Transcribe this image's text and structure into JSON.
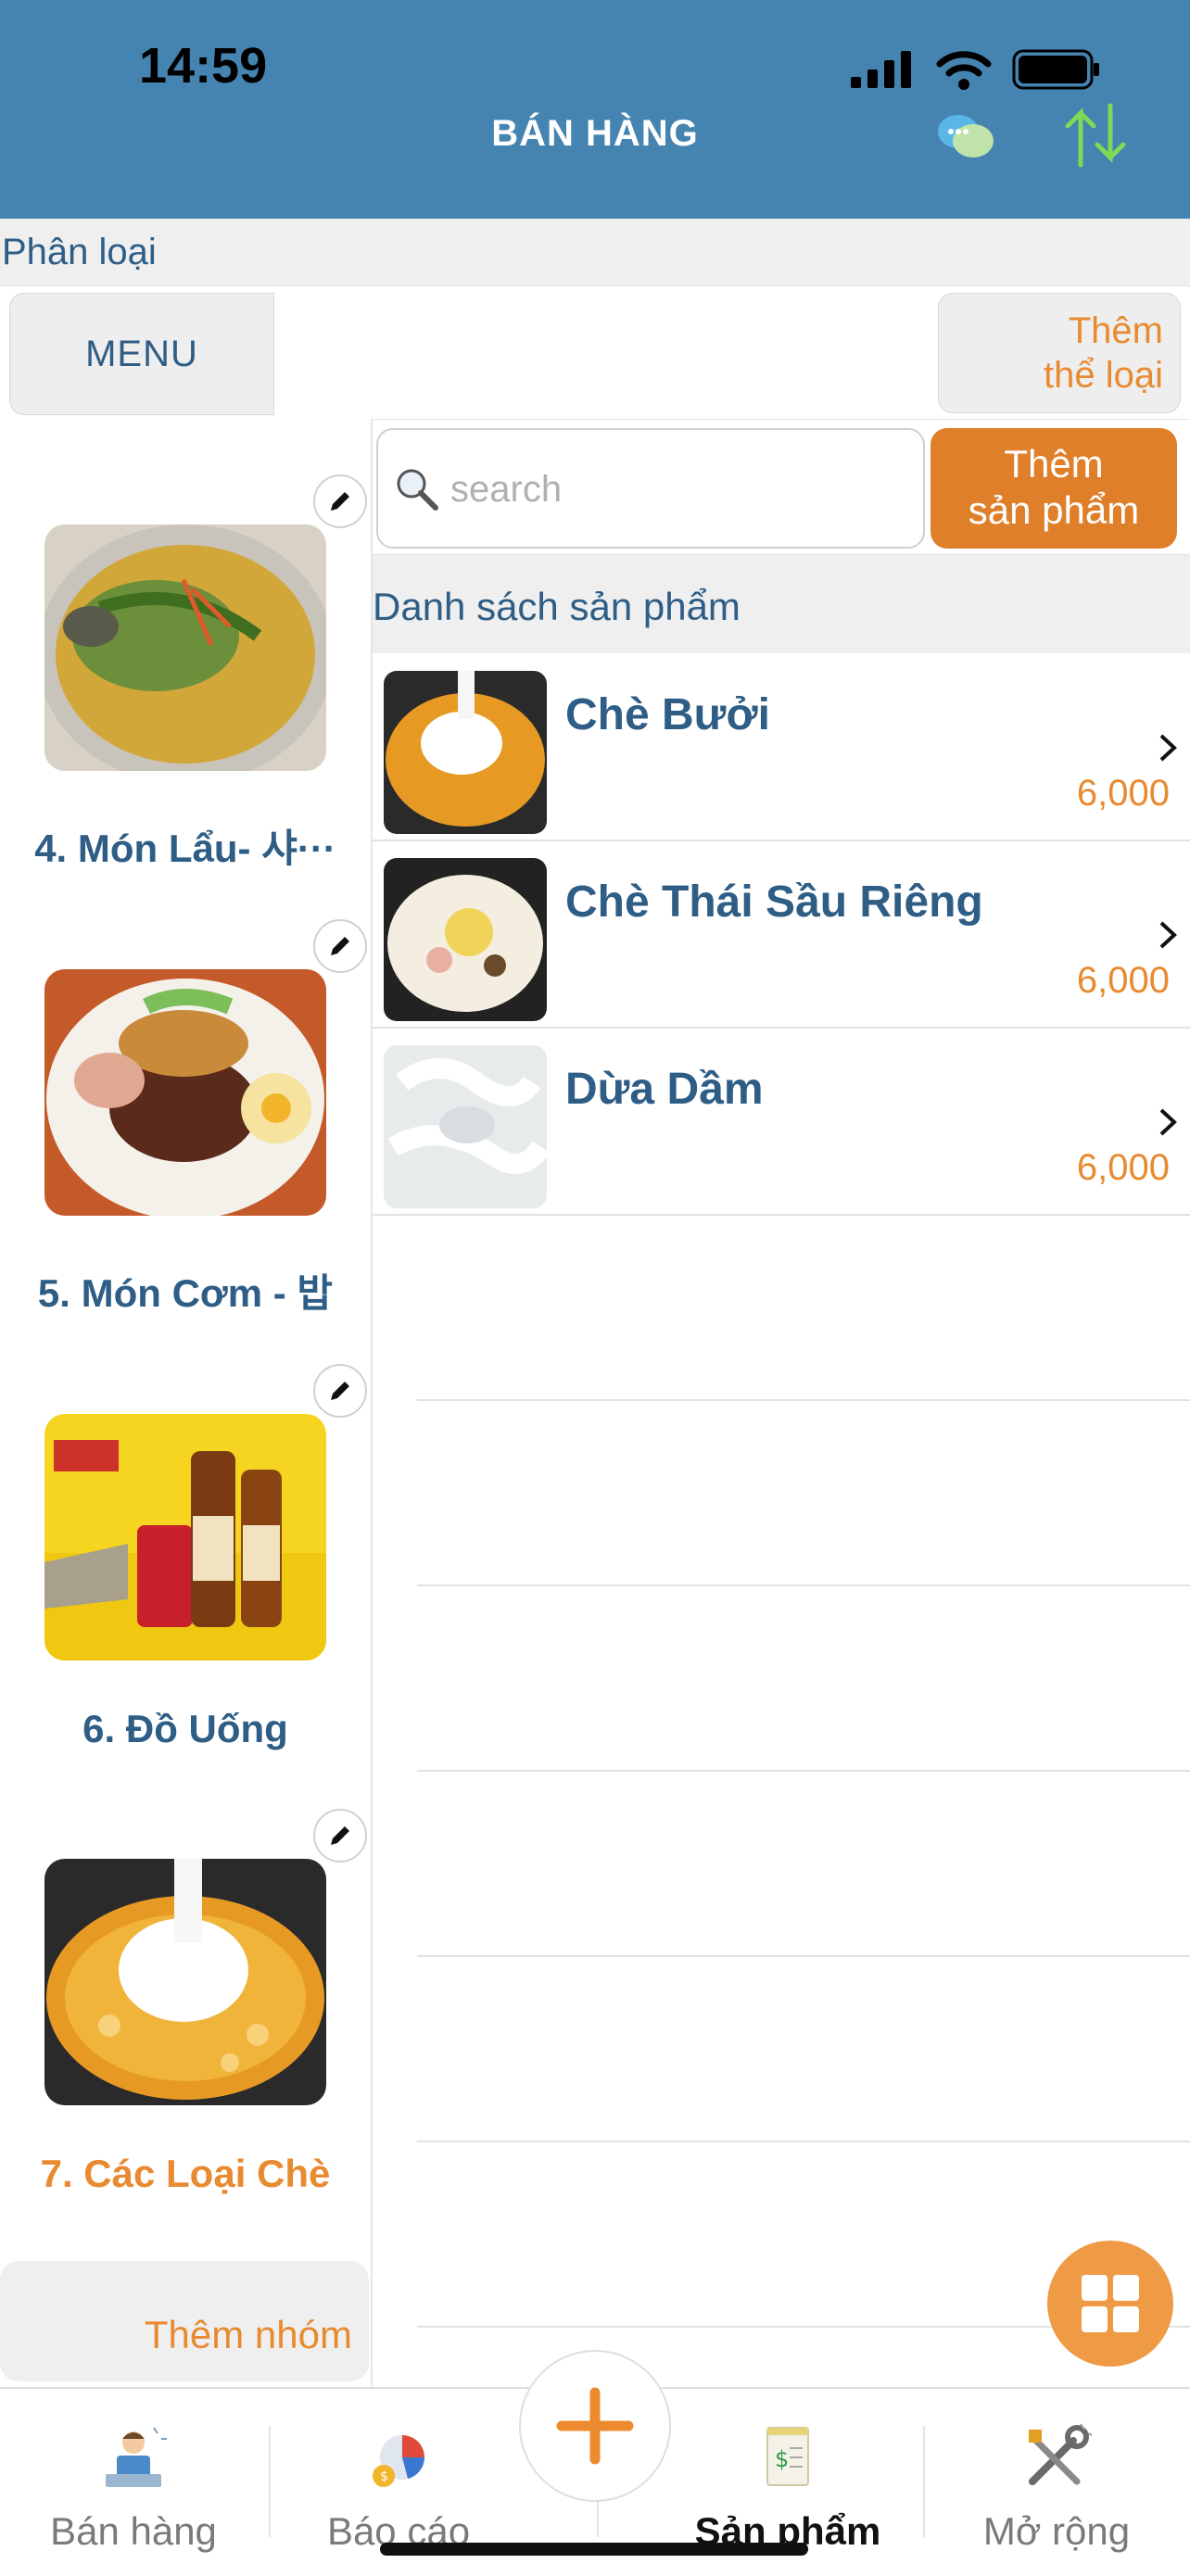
{
  "status_bar": {
    "time": "14:59"
  },
  "header": {
    "title": "BÁN HÀNG"
  },
  "section": {
    "title": "Phân loại"
  },
  "categories": {
    "menu_label": "MENU",
    "add_line1": "Thêm",
    "add_line2": "thể loại"
  },
  "groups": [
    {
      "label": "4. Món Lẩu- 샤···",
      "icon": "hotpot-fish-photo",
      "active": false
    },
    {
      "label": "5. Món Cơm - 밥",
      "icon": "rice-pork-photo",
      "active": false
    },
    {
      "label": "6. Đồ Uống",
      "icon": "beer-photo",
      "active": false
    },
    {
      "label": "7. Các Loại Chè",
      "icon": "sweet-soup-photo",
      "active": true
    }
  ],
  "add_group_label": "Thêm nhóm",
  "search": {
    "placeholder": "search"
  },
  "add_product": {
    "line1": "Thêm",
    "line2": "sản phẩm"
  },
  "product_list": {
    "title": "Danh sách sản phẩm",
    "items": [
      {
        "name": "Chè Bưởi",
        "price": "6,000",
        "icon": "che-buoi-photo"
      },
      {
        "name": "Chè Thái Sầu Riêng",
        "price": "6,000",
        "icon": "che-thai-photo"
      },
      {
        "name": "Dừa Dầm",
        "price": "6,000",
        "icon": "dua-dam-photo"
      }
    ]
  },
  "tabs": [
    {
      "label": "Bán hàng",
      "icon": "cashier-icon",
      "active": false
    },
    {
      "label": "Báo cáo",
      "icon": "report-chart-icon",
      "active": false
    },
    {
      "label": "Sản phẩm",
      "icon": "product-receipt-icon",
      "active": true
    },
    {
      "label": "Mở rộng",
      "icon": "tools-icon",
      "active": false
    }
  ],
  "colors": {
    "header_bg": "#4584b0",
    "accent_orange": "#e88a30",
    "text_blue": "#2e5d86"
  }
}
